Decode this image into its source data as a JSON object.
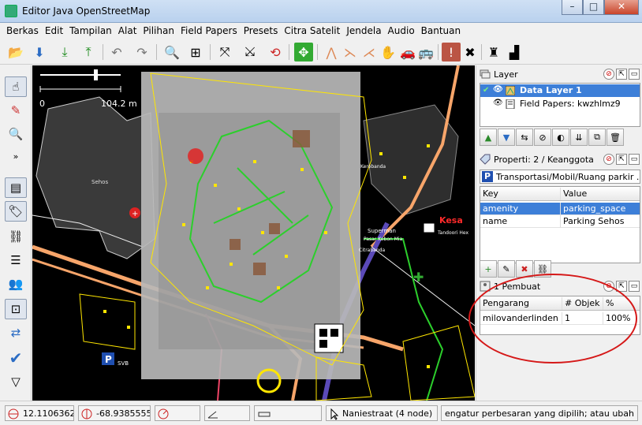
{
  "window": {
    "title": "Editor Java OpenStreetMap"
  },
  "menu": [
    "Berkas",
    "Edit",
    "Tampilan",
    "Alat",
    "Pilihan",
    "Field Papers",
    "Presets",
    "Citra Satelit",
    "Jendela",
    "Audio",
    "Bantuan"
  ],
  "map": {
    "scale_start": "0",
    "scale_end": "104.2 m",
    "labels": {
      "sehos": "Sehos",
      "superman": "Superman",
      "pasar": "Pasar Kebon Mia",
      "citrabanda": "Citrabanda",
      "tandoori": "Tandoori Hex",
      "kesa": "Kesa",
      "svb": "SVB",
      "kerobanda": "Kerobanda"
    }
  },
  "layers": {
    "title": "Layer",
    "items": [
      {
        "name": "Data Layer 1",
        "selected": true
      },
      {
        "name": "Field Papers: kwzhlmz9",
        "selected": false
      }
    ]
  },
  "properties": {
    "title": "Properti: 2 / Keanggota",
    "type": "Transportasi/Mobil/Ruang parkir ...",
    "columns": [
      "Key",
      "Value"
    ],
    "rows": [
      {
        "key": "amenity",
        "value": "parking_space"
      },
      {
        "key": "name",
        "value": "Parking Sehos"
      }
    ]
  },
  "authors": {
    "title": "1 Pembuat",
    "columns": [
      "Pengarang",
      "# Objek",
      "%"
    ],
    "rows": [
      {
        "name": "milovanderlinden",
        "count": "1",
        "percent": "100%"
      }
    ]
  },
  "status": {
    "lat": "12.1106362",
    "lon": "-68.9385555",
    "node": "Naniestraat (4 node)",
    "help": "engatur perbesaran yang dipilih; atau ubah pilihan"
  },
  "colors": {
    "selection": "#3d7fd8",
    "annotation": "#d51818",
    "map_bg": "#000000"
  }
}
